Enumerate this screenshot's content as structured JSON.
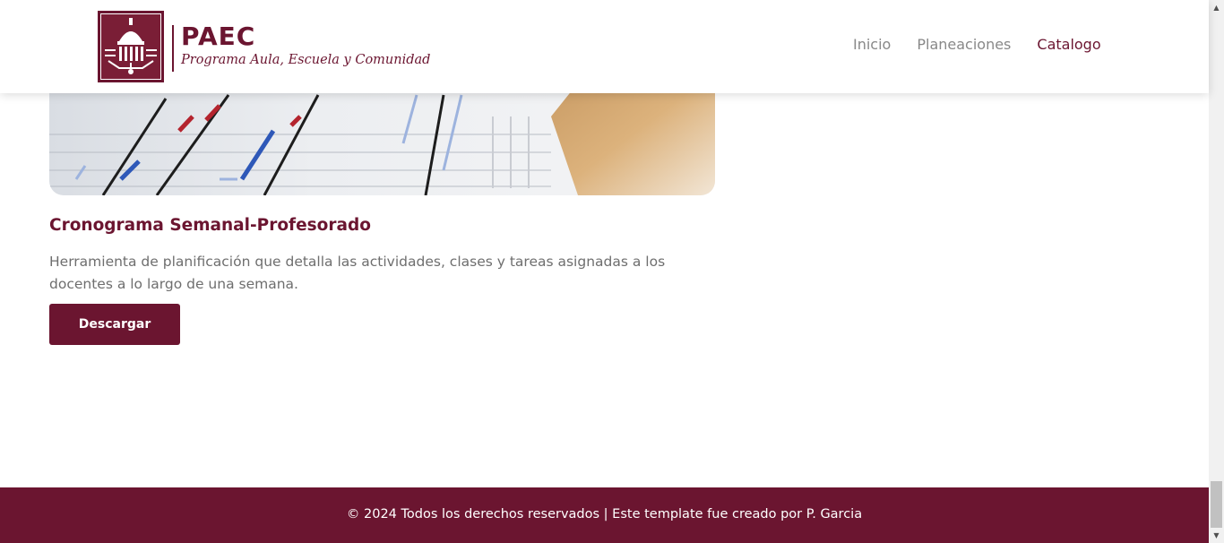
{
  "header": {
    "logo": {
      "name": "PAEC",
      "subtitle": "Programa Aula, Escuela y Comunidad",
      "emblem_icon": "capitol-building-icon"
    },
    "nav": [
      {
        "label": "Inicio",
        "active": false
      },
      {
        "label": "Planeaciones",
        "active": false
      },
      {
        "label": "Catalogo",
        "active": true
      }
    ]
  },
  "card": {
    "image_icon": "gantt-chart-photo",
    "title": "Cronograma Semanal-Profesorado",
    "description": "Herramienta de planificación que detalla las actividades, clases y tareas asignadas a los docentes a lo largo de una semana.",
    "button_label": "Descargar"
  },
  "footer": {
    "text": "© 2024 Todos los derechos reservados | Este template fue creado por P. Garcia"
  },
  "colors": {
    "brand": "#6b1530",
    "nav_inactive": "#888888",
    "body_text": "#6e6e6e",
    "footer_text": "#ffffff"
  }
}
